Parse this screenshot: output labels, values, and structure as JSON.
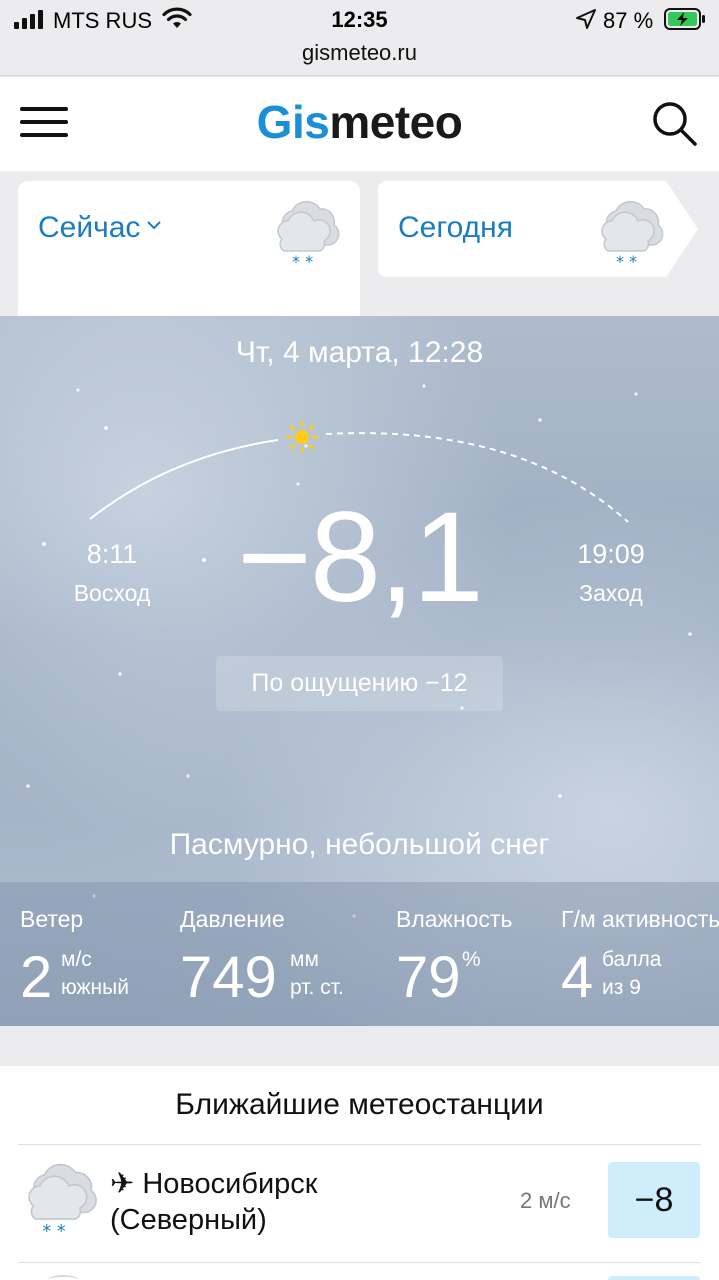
{
  "status_bar": {
    "carrier": "MTS RUS",
    "time": "12:35",
    "battery": "87 %",
    "url": "gismeteo.ru"
  },
  "header": {
    "logo_part1": "Gis",
    "logo_part2": "meteo",
    "brand_color": "#1a8fd6"
  },
  "tabs": [
    {
      "label": "Сейчас",
      "active": true,
      "icon": "cloud-snow-icon"
    },
    {
      "label": "Сегодня",
      "active": false,
      "icon": "cloud-snow-icon"
    }
  ],
  "current": {
    "date_time": "Чт, 4 марта, 12:28",
    "sunrise_time": "8:11",
    "sunrise_label": "Восход",
    "sunset_time": "19:09",
    "sunset_label": "Заход",
    "temperature": "−8,1",
    "feels_like": "По ощущению −12",
    "condition": "Пасмурно, небольшой снег"
  },
  "details": {
    "wind": {
      "label": "Ветер",
      "value": "2",
      "unit1": "м/с",
      "unit2": "южный"
    },
    "pressure": {
      "label": "Давление",
      "value": "749",
      "unit1": "мм",
      "unit2": "рт. ст."
    },
    "humidity": {
      "label": "Влажность",
      "value": "79",
      "unit1": "%"
    },
    "geomagnetic": {
      "label": "Г/м активность",
      "value": "4",
      "unit1": "балла",
      "unit2": "из 9"
    }
  },
  "stations": {
    "title": "Ближайшие метеостанции",
    "items": [
      {
        "name_line1": "✈ Новосибирск",
        "name_line2": "(Северный)",
        "wind": "2 м/с",
        "temp": "−8"
      }
    ]
  }
}
